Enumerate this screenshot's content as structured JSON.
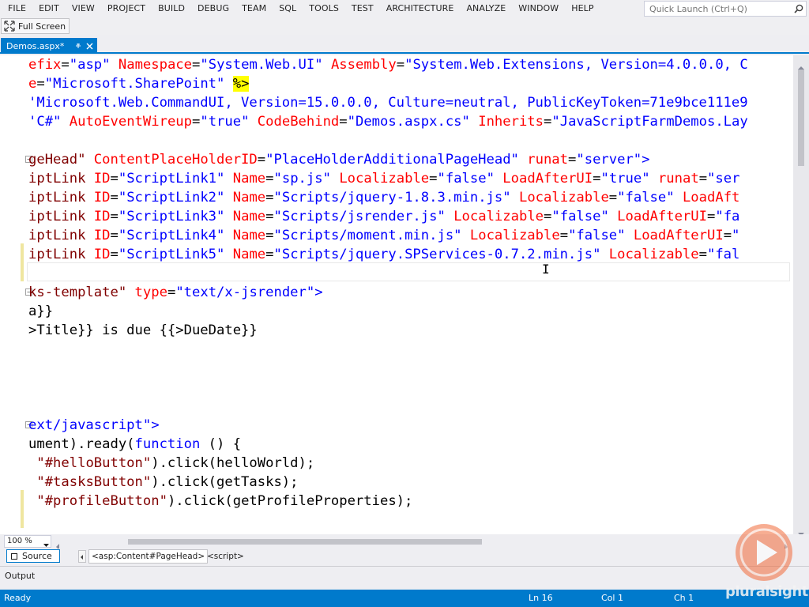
{
  "menu": [
    "FILE",
    "EDIT",
    "VIEW",
    "PROJECT",
    "BUILD",
    "DEBUG",
    "TEAM",
    "SQL",
    "TOOLS",
    "TEST",
    "ARCHITECTURE",
    "ANALYZE",
    "WINDOW",
    "HELP"
  ],
  "quick_launch": {
    "placeholder": "Quick Launch (Ctrl+Q)",
    "icon": "search-icon"
  },
  "toolbar": {
    "full_screen_label": "Full Screen"
  },
  "tab": {
    "label": "Demos.aspx*"
  },
  "code_lines": [
    [
      [
        "t-attr",
        "efix"
      ],
      [
        "t-plain",
        "="
      ],
      [
        "t-str",
        "\"asp\""
      ],
      [
        "t-plain",
        " "
      ],
      [
        "t-attr",
        "Namespace"
      ],
      [
        "t-plain",
        "="
      ],
      [
        "t-str",
        "\"System.Web.UI\""
      ],
      [
        "t-plain",
        " "
      ],
      [
        "t-attr",
        "Assembly"
      ],
      [
        "t-plain",
        "="
      ],
      [
        "t-str",
        "\"System.Web.Extensions, Version=4.0.0.0, C"
      ]
    ],
    [
      [
        "t-attr",
        "e"
      ],
      [
        "t-plain",
        "="
      ],
      [
        "t-str",
        "\"Microsoft.SharePoint\""
      ],
      [
        "t-plain",
        " "
      ],
      [
        "t-dir",
        "%>"
      ]
    ],
    [
      [
        "t-str",
        "'Microsoft.Web.CommandUI, Version=15.0.0.0, Culture=neutral, PublicKeyToken=71e9bce111e9"
      ]
    ],
    [
      [
        "t-str",
        "'C#\""
      ],
      [
        "t-plain",
        " "
      ],
      [
        "t-attr",
        "AutoEventWireup"
      ],
      [
        "t-plain",
        "="
      ],
      [
        "t-str",
        "\"true\""
      ],
      [
        "t-plain",
        " "
      ],
      [
        "t-attr",
        "CodeBehind"
      ],
      [
        "t-plain",
        "="
      ],
      [
        "t-str",
        "\"Demos.aspx.cs\""
      ],
      [
        "t-plain",
        " "
      ],
      [
        "t-attr",
        "Inherits"
      ],
      [
        "t-plain",
        "="
      ],
      [
        "t-str",
        "\"JavaScriptFarmDemos.Lay"
      ]
    ],
    [],
    [
      [
        "t-tag",
        "geHead\""
      ],
      [
        "t-plain",
        " "
      ],
      [
        "t-attr",
        "ContentPlaceHolderID"
      ],
      [
        "t-plain",
        "="
      ],
      [
        "t-str",
        "\"PlaceHolderAdditionalPageHead\""
      ],
      [
        "t-plain",
        " "
      ],
      [
        "t-attr",
        "runat"
      ],
      [
        "t-plain",
        "="
      ],
      [
        "t-str",
        "\"server\""
      ],
      [
        "t-str",
        ">"
      ]
    ],
    [
      [
        "t-tag",
        "iptLink"
      ],
      [
        "t-plain",
        " "
      ],
      [
        "t-attr",
        "ID"
      ],
      [
        "t-plain",
        "="
      ],
      [
        "t-str",
        "\"ScriptLink1\""
      ],
      [
        "t-plain",
        " "
      ],
      [
        "t-attr",
        "Name"
      ],
      [
        "t-plain",
        "="
      ],
      [
        "t-str",
        "\"sp.js\""
      ],
      [
        "t-plain",
        " "
      ],
      [
        "t-attr",
        "Localizable"
      ],
      [
        "t-plain",
        "="
      ],
      [
        "t-str",
        "\"false\""
      ],
      [
        "t-plain",
        " "
      ],
      [
        "t-attr",
        "LoadAfterUI"
      ],
      [
        "t-plain",
        "="
      ],
      [
        "t-str",
        "\"true\""
      ],
      [
        "t-plain",
        " "
      ],
      [
        "t-attr",
        "runat"
      ],
      [
        "t-plain",
        "="
      ],
      [
        "t-str",
        "\"ser"
      ]
    ],
    [
      [
        "t-tag",
        "iptLink"
      ],
      [
        "t-plain",
        " "
      ],
      [
        "t-attr",
        "ID"
      ],
      [
        "t-plain",
        "="
      ],
      [
        "t-str",
        "\"ScriptLink2\""
      ],
      [
        "t-plain",
        " "
      ],
      [
        "t-attr",
        "Name"
      ],
      [
        "t-plain",
        "="
      ],
      [
        "t-str",
        "\"Scripts/jquery-1.8.3.min.js\""
      ],
      [
        "t-plain",
        " "
      ],
      [
        "t-attr",
        "Localizable"
      ],
      [
        "t-plain",
        "="
      ],
      [
        "t-str",
        "\"false\""
      ],
      [
        "t-plain",
        " "
      ],
      [
        "t-attr",
        "LoadAft"
      ]
    ],
    [
      [
        "t-tag",
        "iptLink"
      ],
      [
        "t-plain",
        " "
      ],
      [
        "t-attr",
        "ID"
      ],
      [
        "t-plain",
        "="
      ],
      [
        "t-str",
        "\"ScriptLink3\""
      ],
      [
        "t-plain",
        " "
      ],
      [
        "t-attr",
        "Name"
      ],
      [
        "t-plain",
        "="
      ],
      [
        "t-str",
        "\"Scripts/jsrender.js\""
      ],
      [
        "t-plain",
        " "
      ],
      [
        "t-attr",
        "Localizable"
      ],
      [
        "t-plain",
        "="
      ],
      [
        "t-str",
        "\"false\""
      ],
      [
        "t-plain",
        " "
      ],
      [
        "t-attr",
        "LoadAfterUI"
      ],
      [
        "t-plain",
        "="
      ],
      [
        "t-str",
        "\"fa"
      ]
    ],
    [
      [
        "t-tag",
        "iptLink"
      ],
      [
        "t-plain",
        " "
      ],
      [
        "t-attr",
        "ID"
      ],
      [
        "t-plain",
        "="
      ],
      [
        "t-str",
        "\"ScriptLink4\""
      ],
      [
        "t-plain",
        " "
      ],
      [
        "t-attr",
        "Name"
      ],
      [
        "t-plain",
        "="
      ],
      [
        "t-str",
        "\"Scripts/moment.min.js\""
      ],
      [
        "t-plain",
        " "
      ],
      [
        "t-attr",
        "Localizable"
      ],
      [
        "t-plain",
        "="
      ],
      [
        "t-str",
        "\"false\""
      ],
      [
        "t-plain",
        " "
      ],
      [
        "t-attr",
        "LoadAfterUI"
      ],
      [
        "t-plain",
        "="
      ],
      [
        "t-str",
        "\""
      ]
    ],
    [
      [
        "t-tag",
        "iptLink"
      ],
      [
        "t-plain",
        " "
      ],
      [
        "t-attr",
        "ID"
      ],
      [
        "t-plain",
        "="
      ],
      [
        "t-str",
        "\"ScriptLink5\""
      ],
      [
        "t-plain",
        " "
      ],
      [
        "t-attr",
        "Name"
      ],
      [
        "t-plain",
        "="
      ],
      [
        "t-str",
        "\"Scripts/jquery.SPServices-0.7.2.min.js\""
      ],
      [
        "t-plain",
        " "
      ],
      [
        "t-attr",
        "Localizable"
      ],
      [
        "t-plain",
        "="
      ],
      [
        "t-str",
        "\"fal"
      ]
    ],
    [],
    [
      [
        "t-tag",
        "ks-template\""
      ],
      [
        "t-plain",
        " "
      ],
      [
        "t-attr",
        "type"
      ],
      [
        "t-plain",
        "="
      ],
      [
        "t-str",
        "\"text/x-jsrender\""
      ],
      [
        "t-str",
        ">"
      ]
    ],
    [
      [
        "t-plain",
        "a}}"
      ]
    ],
    [
      [
        "t-plain",
        ">Title}} is due {{>DueDate}}"
      ]
    ],
    [],
    [],
    [],
    [],
    [
      [
        "t-str",
        "ext/javascript\""
      ],
      [
        "t-str",
        ">"
      ]
    ],
    [
      [
        "t-plain",
        "ument).ready("
      ],
      [
        "t-str",
        "function"
      ],
      [
        "t-plain",
        " () {"
      ]
    ],
    [
      [
        "t-plain",
        " "
      ],
      [
        "t-tag",
        "\"#helloButton\""
      ],
      [
        "t-plain",
        ").click(helloWorld);"
      ]
    ],
    [
      [
        "t-plain",
        " "
      ],
      [
        "t-tag",
        "\"#tasksButton\""
      ],
      [
        "t-plain",
        ").click(getTasks);"
      ]
    ],
    [
      [
        "t-plain",
        " "
      ],
      [
        "t-tag",
        "\"#profileButton\""
      ],
      [
        "t-plain",
        ").click(getProfileProperties);"
      ]
    ]
  ],
  "zoom": "100 %",
  "source_bar": {
    "source_label": "Source",
    "breadcrumb_1": "<asp:Content#PageHead>",
    "breadcrumb_2": "<script>"
  },
  "output": {
    "label": "Output"
  },
  "status": {
    "ready": "Ready",
    "line": "Ln 16",
    "col": "Col 1",
    "ch": "Ch 1"
  },
  "watermark": {
    "text": "pluralsight"
  },
  "colors": {
    "accent": "#007acc",
    "tag": "#800000",
    "attr": "#ff0000",
    "string": "#0000ff"
  }
}
